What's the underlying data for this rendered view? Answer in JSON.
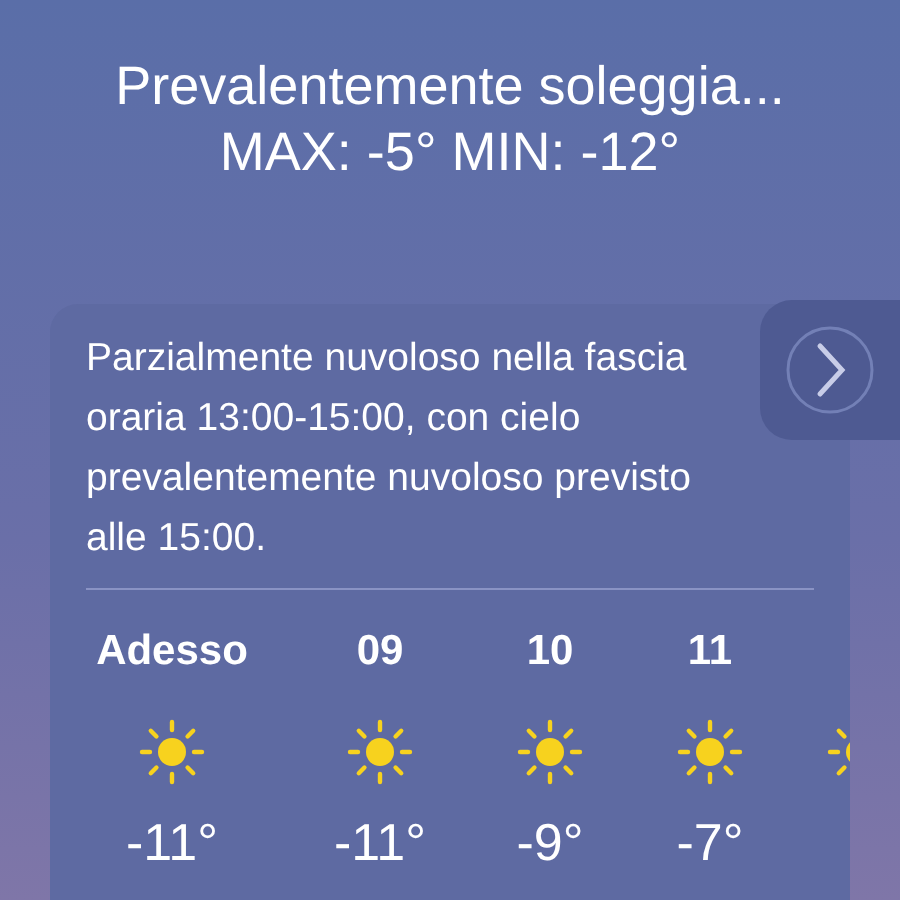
{
  "summary": {
    "condition": "Prevalentemente soleggia...",
    "high_low": "MAX: -5°  MIN: -12°"
  },
  "forecast_card": {
    "description": "Parzialmente nuvoloso nella fascia oraria 13:00-15:00, con cielo prevalentemente nuvoloso previsto alle 15:00.",
    "hours": [
      {
        "time": "Adesso",
        "temp": "-11°",
        "kind": "sun"
      },
      {
        "time": "09",
        "temp": "-11°",
        "kind": "sun"
      },
      {
        "time": "10",
        "temp": "-9°",
        "kind": "sun"
      },
      {
        "time": "11",
        "temp": "-7°",
        "kind": "sun"
      },
      {
        "kind": "sun"
      }
    ]
  }
}
